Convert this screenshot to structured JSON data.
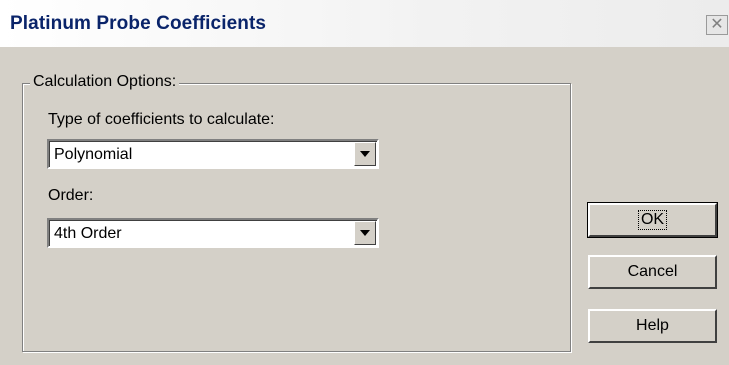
{
  "window": {
    "title": "Platinum Probe Coefficients",
    "close_symbol": "✕"
  },
  "group": {
    "legend": "Calculation Options:"
  },
  "type_field": {
    "label": "Type of coefficients to calculate:",
    "value": "Polynomial"
  },
  "order_field": {
    "label": "Order:",
    "value": "4th Order"
  },
  "buttons": {
    "ok": "OK",
    "cancel": "Cancel",
    "help": "Help"
  }
}
